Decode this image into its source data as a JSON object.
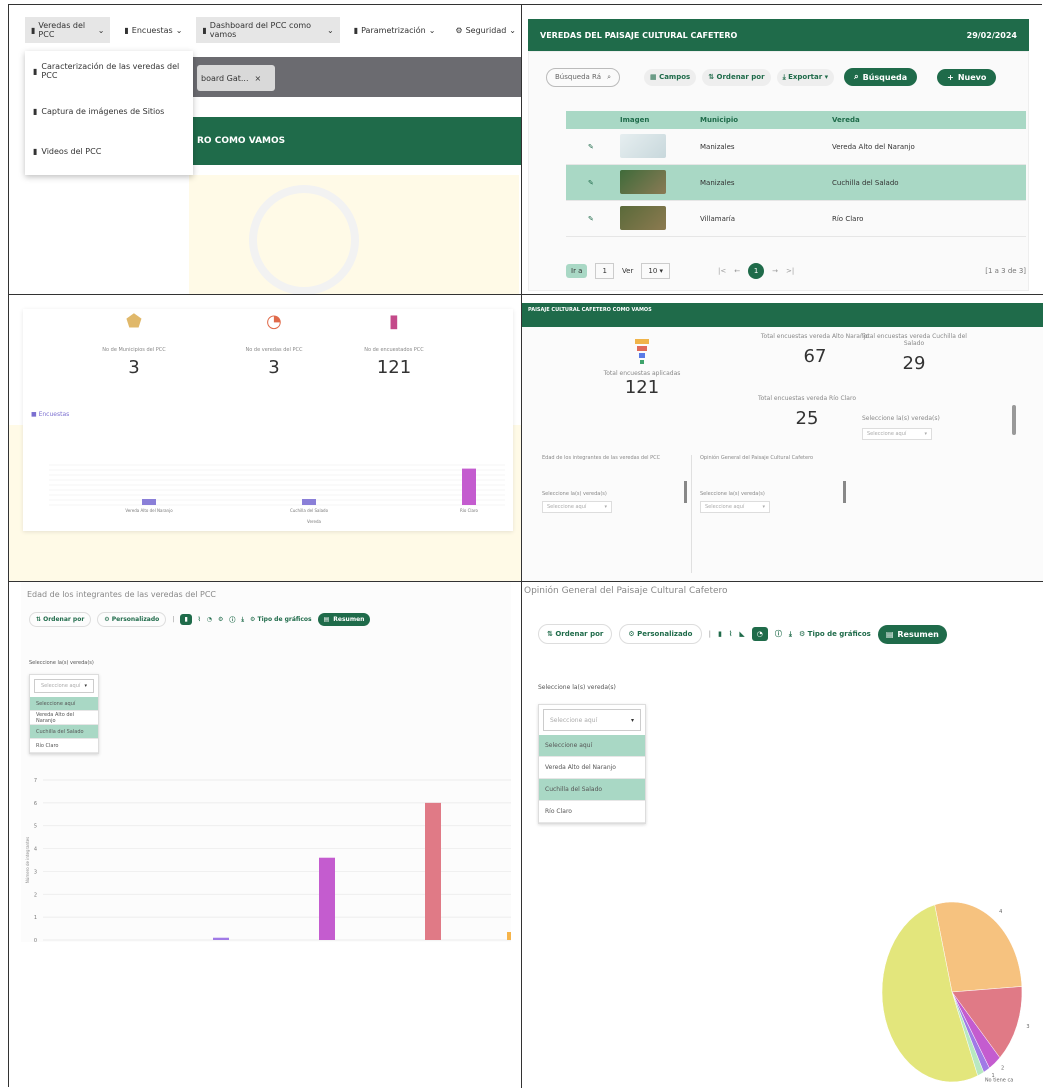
{
  "panel1": {
    "menu": [
      {
        "label": "Veredas del PCC"
      },
      {
        "label": "Encuestas"
      },
      {
        "label": "Dashboard del PCC como vamos"
      },
      {
        "label": "Parametrización"
      },
      {
        "label": "Seguridad"
      }
    ],
    "dropdown_items": [
      "Caracterización de las veredas del PCC",
      "Captura de imágenes de Sitios",
      "Videos del PCC"
    ],
    "tab_label": "board Gat...",
    "banner_text": "RO COMO VAMOS"
  },
  "panel2": {
    "header_title": "VEREDAS DEL PAISAJE CULTURAL CAFETERO",
    "header_date": "29/02/2024",
    "search_placeholder": "Búsqueda Rá",
    "toolbar": {
      "campos": "Campos",
      "ordenar": "Ordenar por",
      "exportar": "Exportar",
      "busqueda": "Búsqueda",
      "nuevo": "Nuevo"
    },
    "table_headers": [
      "Imagen",
      "Municipio",
      "Vereda"
    ],
    "rows": [
      {
        "municipio": "Manizales",
        "vereda": "Vereda Alto del Naranjo"
      },
      {
        "municipio": "Manizales",
        "vereda": "Cuchilla del Salado"
      },
      {
        "municipio": "Villamaría",
        "vereda": "Río Claro"
      }
    ],
    "pager": {
      "ira": "Ir a",
      "page_input": "1",
      "ver": "Ver",
      "page_size": "10",
      "current_page": "1",
      "range": "[1 a 3 de 3]"
    }
  },
  "panel3": {
    "kpis": [
      {
        "label": "No de Municipios del PCC",
        "value": "3"
      },
      {
        "label": "No de veredas del PCC",
        "value": "3"
      },
      {
        "label": "No de encuestados PCC",
        "value": "121"
      }
    ],
    "legend": "Encuestas",
    "chart_data": {
      "type": "bar",
      "categories": [
        "Vereda Alto del Naranjo",
        "Cuchilla del Salado",
        "Río Claro"
      ],
      "values": [
        15,
        15,
        91
      ],
      "xlabel": "Vereda",
      "colors": [
        "#8a7fd8",
        "#8a7fd8",
        "#c45ccf"
      ]
    }
  },
  "panel4": {
    "header": "PAISAJE CULTURAL CAFETERO COMO VAMOS",
    "kpis": [
      {
        "label": "Total encuestas aplicadas",
        "value": "121"
      },
      {
        "label": "Total encuestas vereda Alto Naranjo",
        "value": "67"
      },
      {
        "label": "Total encuestas vereda Cuchilla del Salado",
        "value": "29"
      },
      {
        "label": "Total encuestas vereda Río Claro",
        "value": "25"
      }
    ],
    "select_label": "Seleccione la(s) vereda(s)",
    "select_placeholder": "Seleccione aquí",
    "widget_titles": [
      "Edad de los integrantes de las veredas del PCC",
      "Opinión General del Paisaje Cultural Cafetero"
    ]
  },
  "panel5": {
    "title": "Edad de los integrantes de las veredas del PCC",
    "toolbar": {
      "ordenar": "Ordenar por",
      "personalizado": "Personalizado",
      "tipo": "Tipo de gráficos",
      "resumen": "Resumen"
    },
    "select_label": "Seleccione la(s) vereda(s)",
    "options": [
      "Seleccione aquí",
      "Seleccione aquí",
      "Vereda Alto del Naranjo",
      "Cuchilla del Salado",
      "Río Claro"
    ],
    "ylabel": "Número de integrantes",
    "chart_data": {
      "type": "bar",
      "values": [
        0.1,
        3.6,
        6
      ],
      "ylim": [
        0,
        7
      ],
      "ticks": [
        "0",
        "1",
        "2",
        "3",
        "4",
        "5",
        "6",
        "7"
      ],
      "colors": [
        "#a07ae6",
        "#c45ccf",
        "#e07a86"
      ]
    }
  },
  "panel6": {
    "title": "Opinión General del Paisaje Cultural Cafetero",
    "toolbar": {
      "ordenar": "Ordenar por",
      "personalizado": "Personalizado",
      "tipo": "Tipo de gráficos",
      "resumen": "Resumen"
    },
    "select_label": "Seleccione la(s) vereda(s)",
    "options": [
      "Seleccione aquí",
      "Seleccione aquí",
      "Vereda Alto del Naranjo",
      "Cuchilla del Salado",
      "Río Claro"
    ],
    "chart_data": {
      "type": "pie",
      "slices": [
        {
          "label": "4",
          "value": 28,
          "color": "#f6c27f"
        },
        {
          "label": "3",
          "value": 14,
          "color": "#e07a86"
        },
        {
          "label": "2",
          "value": 3,
          "color": "#c45ccf"
        },
        {
          "label": "1",
          "value": 1.5,
          "color": "#a07ae6"
        },
        {
          "label": "No tiene ca",
          "value": 1.5,
          "color": "#b8e8c0"
        },
        {
          "label": "",
          "value": 52,
          "color": "#e3e67c"
        }
      ]
    }
  }
}
